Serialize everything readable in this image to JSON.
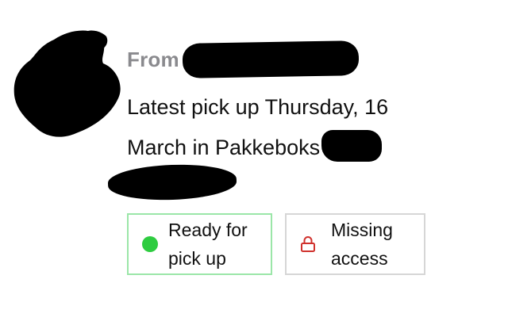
{
  "shipment": {
    "from_label": "From",
    "pickup_line1": "Latest pick up Thursday, 16",
    "pickup_line2": "March in Pakkeboks"
  },
  "chips": {
    "ready": {
      "label_line1": "Ready for",
      "label_line2": "pick up",
      "icon": "green-dot-icon",
      "color": "#2ecc40",
      "border_color": "#9be6a8"
    },
    "access": {
      "label_line1": "Missing",
      "label_line2": "access",
      "icon": "lock-icon",
      "color": "#d0312d",
      "border_color": "#d6d6d6"
    }
  }
}
